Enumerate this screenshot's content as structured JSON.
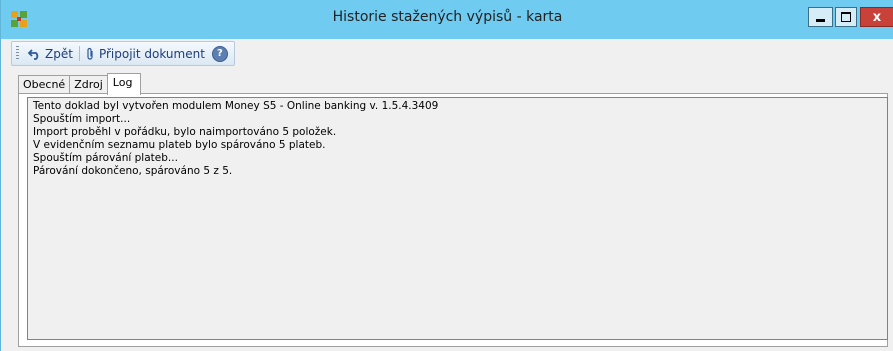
{
  "window": {
    "title": "Historie stažených výpisů - karta",
    "controls": {
      "minimize": "",
      "maximize": "",
      "close": "x"
    }
  },
  "toolbar": {
    "back_label": "Zpět",
    "attach_label": "Připojit dokument",
    "help_label": "?"
  },
  "tabs": [
    {
      "label": "Obecné",
      "active": false
    },
    {
      "label": "Zdroj",
      "active": false
    },
    {
      "label": "Log",
      "active": true
    }
  ],
  "log": {
    "lines": [
      "Tento doklad byl vytvořen modulem Money S5 - Online banking v. 1.5.4.3409",
      "Spouštím import...",
      "Import proběhl v pořádku, bylo naimportováno 5 položek.",
      "V evidenčním seznamu plateb bylo spárováno 5 plateb.",
      "Spouštím párování plateb...",
      "Párování dokončeno, spárováno 5 z 5."
    ]
  },
  "colors": {
    "titlebar": "#6fcbf0",
    "close_button": "#c8423a"
  },
  "icons": {
    "app": "money-app-icon",
    "back": "undo-arrow-icon",
    "attach": "paperclip-icon",
    "help": "help-icon"
  }
}
